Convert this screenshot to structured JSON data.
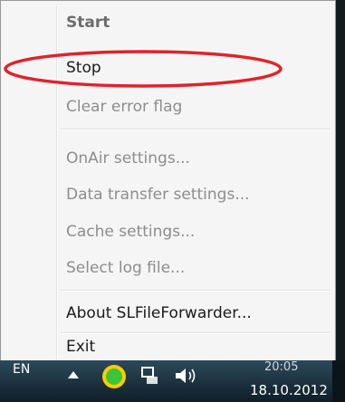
{
  "menu": {
    "items": [
      {
        "label": "Start",
        "state": "disabled-bold"
      },
      {
        "label": "Stop",
        "state": "enabled"
      },
      {
        "label": "Clear error flag",
        "state": "disabled"
      },
      {
        "label": "OnAir settings...",
        "state": "disabled"
      },
      {
        "label": "Data transfer settings...",
        "state": "disabled"
      },
      {
        "label": "Cache settings...",
        "state": "disabled"
      },
      {
        "label": "Select log file...",
        "state": "disabled"
      },
      {
        "label": "About SLFileForwarder...",
        "state": "enabled"
      },
      {
        "label": "Exit",
        "state": "enabled"
      }
    ]
  },
  "annotation": {
    "color": "#e0232b"
  },
  "taskbar": {
    "language": "EN",
    "time": "20:05",
    "date": "18.10.2012",
    "icons": [
      "chevron-up-icon",
      "app-tray-icon",
      "network-icon",
      "volume-icon"
    ]
  }
}
